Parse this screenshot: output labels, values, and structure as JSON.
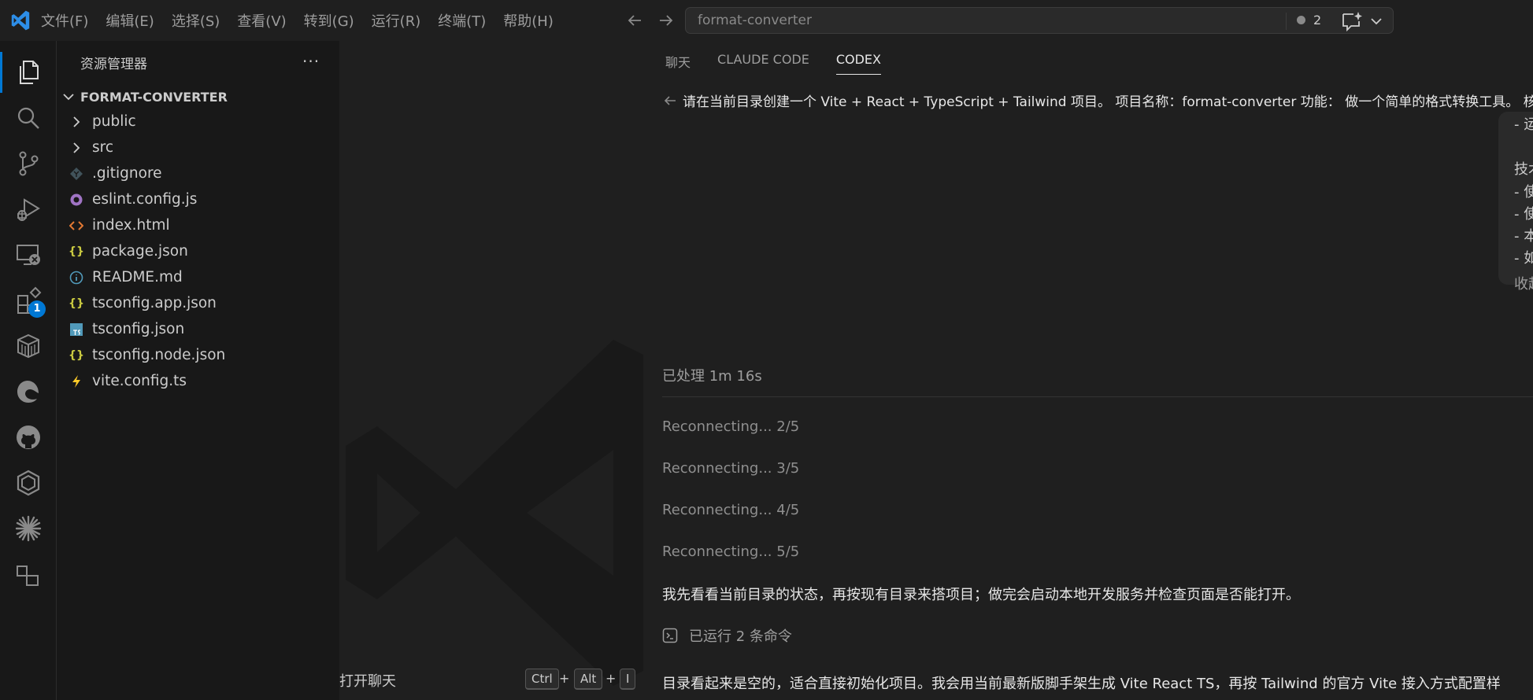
{
  "menubar": {
    "items": [
      "文件(F)",
      "编辑(E)",
      "选择(S)",
      "查看(V)",
      "转到(G)",
      "运行(R)",
      "终端(T)",
      "帮助(H)"
    ]
  },
  "command_center": {
    "text": "format-converter",
    "problems_count": "2"
  },
  "activitybar": {
    "extensions_badge": "1",
    "icons": [
      "explorer-icon",
      "search-icon",
      "source-control-icon",
      "run-debug-icon",
      "remote-explorer-icon",
      "extensions-icon",
      "package-icon",
      "edge-icon",
      "github-icon",
      "gitlens-icon",
      "claude-icon",
      "layout-icon"
    ]
  },
  "explorer": {
    "title": "资源管理器",
    "more": "···",
    "root": "FORMAT-CONVERTER",
    "nodes": [
      {
        "name": "public",
        "kind": "folder"
      },
      {
        "name": "src",
        "kind": "folder"
      },
      {
        "name": ".gitignore",
        "kind": "git"
      },
      {
        "name": "eslint.config.js",
        "kind": "eslint"
      },
      {
        "name": "index.html",
        "kind": "html"
      },
      {
        "name": "package.json",
        "kind": "json"
      },
      {
        "name": "README.md",
        "kind": "info"
      },
      {
        "name": "tsconfig.app.json",
        "kind": "json"
      },
      {
        "name": "tsconfig.json",
        "kind": "ts"
      },
      {
        "name": "tsconfig.node.json",
        "kind": "json"
      },
      {
        "name": "vite.config.ts",
        "kind": "vite"
      }
    ]
  },
  "editor": {
    "open_chat_label": "打开聊天",
    "shortcut": {
      "key1": "Ctrl",
      "plus1": "+",
      "key2": "Alt",
      "plus2": "+",
      "key3": "I"
    }
  },
  "panel": {
    "tabs": [
      "聊天",
      "CLAUDE CODE",
      "CODEX"
    ],
    "active_tab": "CODEX",
    "prompt": "请在当前目录创建一个 Vite + React + TypeScript + Tailwind 项目。 项目名称：format-converter 功能： 做一个简单的格式转换工具。 核",
    "bubble_lines": [
      "- 运",
      "技术",
      "- 使",
      "- 使",
      "- 本",
      "- 如",
      "收起"
    ],
    "processed": "已处理 1m 16s",
    "reconnecting": [
      "Reconnecting... 2/5",
      "Reconnecting... 3/5",
      "Reconnecting... 4/5",
      "Reconnecting... 5/5"
    ],
    "message1": "我先看看当前目录的状态，再按现有目录来搭项目；做完会启动本地开发服务并检查页面是否能打开。",
    "ran_commands": "已运行 2 条命令",
    "message2": "目录看起来是空的，适合直接初始化项目。我会用当前最新版脚手架生成 Vite React TS，再按 Tailwind 的官方 Vite 接入方式配置样"
  },
  "colors": {
    "accent": "#0078d4",
    "json": "#cbcb41",
    "html": "#e37933",
    "eslint": "#a074c4",
    "ts": "#519aba",
    "vite": "#ffca28"
  }
}
